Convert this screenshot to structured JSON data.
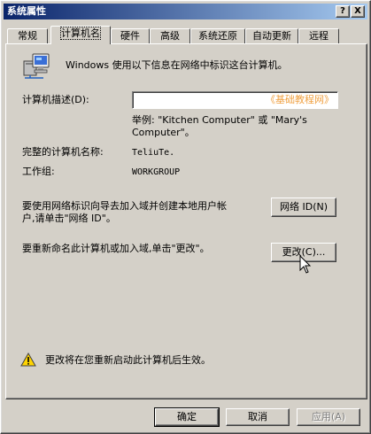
{
  "window": {
    "title": "系统属性",
    "help_btn": "?",
    "close_btn": "X"
  },
  "tabs": [
    {
      "label": "常规"
    },
    {
      "label": "计算机名",
      "active": true
    },
    {
      "label": "硬件"
    },
    {
      "label": "高级"
    },
    {
      "label": "系统还原"
    },
    {
      "label": "自动更新"
    },
    {
      "label": "远程"
    }
  ],
  "intro": "Windows 使用以下信息在网络中标识这台计算机。",
  "description": {
    "label": "计算机描述(D):",
    "value": "",
    "watermark": "《基础教程网》",
    "example_line1": "举例: \"Kitchen Computer\" 或 \"Mary's",
    "example_line2": "Computer\"。"
  },
  "full_name": {
    "label": "完整的计算机名称:",
    "value": "TeliuTe."
  },
  "workgroup": {
    "label": "工作组:",
    "value": "WORKGROUP"
  },
  "network_id": {
    "text_line1": "要使用网络标识向导去加入域并创建本地用户帐",
    "text_line2": "户,请单击\"网络 ID\"。",
    "button": "网络 ID(N)"
  },
  "rename": {
    "text": "要重新命名此计算机或加入域,单击\"更改\"。",
    "button": "更改(C)..."
  },
  "warning": {
    "text": "更改将在您重新启动此计算机后生效。"
  },
  "footer": {
    "ok": "确定",
    "cancel": "取消",
    "apply": "应用(A)"
  }
}
